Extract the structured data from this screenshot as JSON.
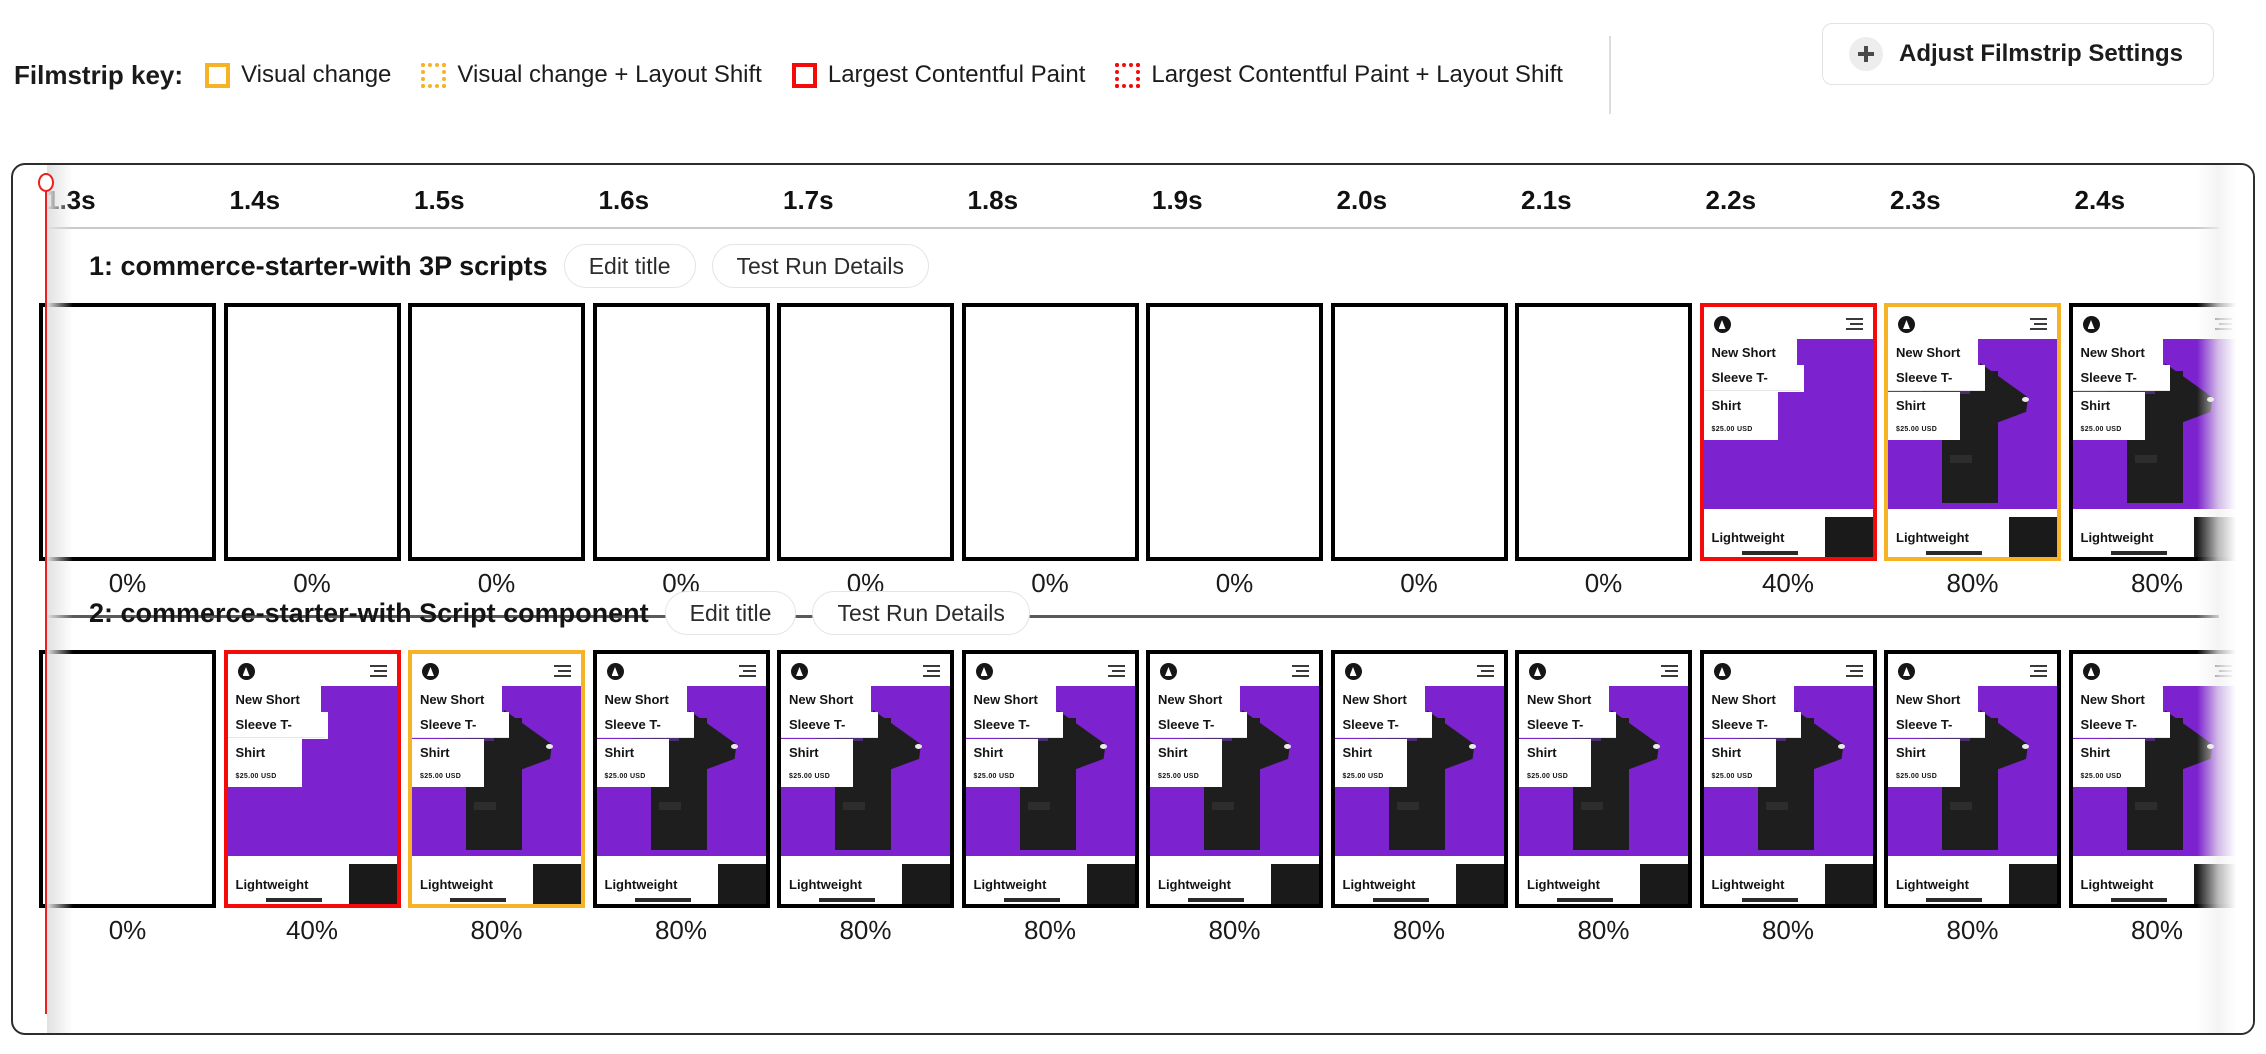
{
  "legend": {
    "label": "Filmstrip key:",
    "items": [
      {
        "name": "visual-change",
        "text": "Visual change",
        "style": "solid-yellow",
        "color": "#f5b325"
      },
      {
        "name": "visual-change-layout-shift",
        "text": "Visual change + Layout Shift",
        "style": "dotted-yellow",
        "color": "#f5b325"
      },
      {
        "name": "largest-contentful-paint",
        "text": "Largest Contentful Paint",
        "style": "solid-red",
        "color": "#f50a0a"
      },
      {
        "name": "largest-contentful-paint-layout-shift",
        "text": "Largest Contentful Paint + Layout Shift",
        "style": "dotted-red",
        "color": "#f50a0a"
      }
    ]
  },
  "settings_button": {
    "label": "Adjust Filmstrip Settings",
    "icon": "plus-icon"
  },
  "timeline": {
    "ticks": [
      "1.3s",
      "1.4s",
      "1.5s",
      "1.6s",
      "1.7s",
      "1.8s",
      "1.9s",
      "2.0s",
      "2.1s",
      "2.2s",
      "2.3s",
      "2.4s"
    ]
  },
  "thumbnail_content": {
    "line1": "New Short",
    "line2": "Sleeve T-",
    "line3": "Shirt",
    "price": "$25.00 USD",
    "footer": "Lightweight"
  },
  "buttons": {
    "edit_title": "Edit title",
    "test_run_details": "Test Run Details"
  },
  "runs": [
    {
      "title": "1: commerce-starter-with 3P scripts",
      "frames": [
        {
          "pct": "0%",
          "border": "black",
          "kind": "blank",
          "clipped": true
        },
        {
          "pct": "0%",
          "border": "black",
          "kind": "blank"
        },
        {
          "pct": "0%",
          "border": "black",
          "kind": "blank"
        },
        {
          "pct": "0%",
          "border": "black",
          "kind": "blank"
        },
        {
          "pct": "0%",
          "border": "black",
          "kind": "blank"
        },
        {
          "pct": "0%",
          "border": "black",
          "kind": "blank"
        },
        {
          "pct": "0%",
          "border": "black",
          "kind": "blank"
        },
        {
          "pct": "0%",
          "border": "black",
          "kind": "blank"
        },
        {
          "pct": "0%",
          "border": "black",
          "kind": "blank"
        },
        {
          "pct": "40%",
          "border": "red",
          "kind": "purple"
        },
        {
          "pct": "80%",
          "border": "yellow",
          "kind": "shirt"
        },
        {
          "pct": "80%",
          "border": "black",
          "kind": "shirt"
        },
        {
          "pct": "",
          "border": "black",
          "kind": "shirt",
          "clipped": true
        }
      ]
    },
    {
      "title": "2: commerce-starter-with Script component",
      "frames": [
        {
          "pct": "0%",
          "border": "black",
          "kind": "blank",
          "clipped": true
        },
        {
          "pct": "40%",
          "border": "red",
          "kind": "purple"
        },
        {
          "pct": "80%",
          "border": "yellow",
          "kind": "shirt"
        },
        {
          "pct": "80%",
          "border": "black",
          "kind": "shirt"
        },
        {
          "pct": "80%",
          "border": "black",
          "kind": "shirt"
        },
        {
          "pct": "80%",
          "border": "black",
          "kind": "shirt"
        },
        {
          "pct": "80%",
          "border": "black",
          "kind": "shirt"
        },
        {
          "pct": "80%",
          "border": "black",
          "kind": "shirt"
        },
        {
          "pct": "80%",
          "border": "black",
          "kind": "shirt"
        },
        {
          "pct": "80%",
          "border": "black",
          "kind": "shirt"
        },
        {
          "pct": "80%",
          "border": "black",
          "kind": "shirt"
        },
        {
          "pct": "80%",
          "border": "black",
          "kind": "shirt"
        },
        {
          "pct": "",
          "border": "black",
          "kind": "shirt",
          "clipped": true
        }
      ]
    }
  ],
  "colors": {
    "accent_yellow": "#f5b325",
    "accent_red": "#f50a0a",
    "marker_red": "#ec2020",
    "hero_purple": "#7c22ce"
  }
}
